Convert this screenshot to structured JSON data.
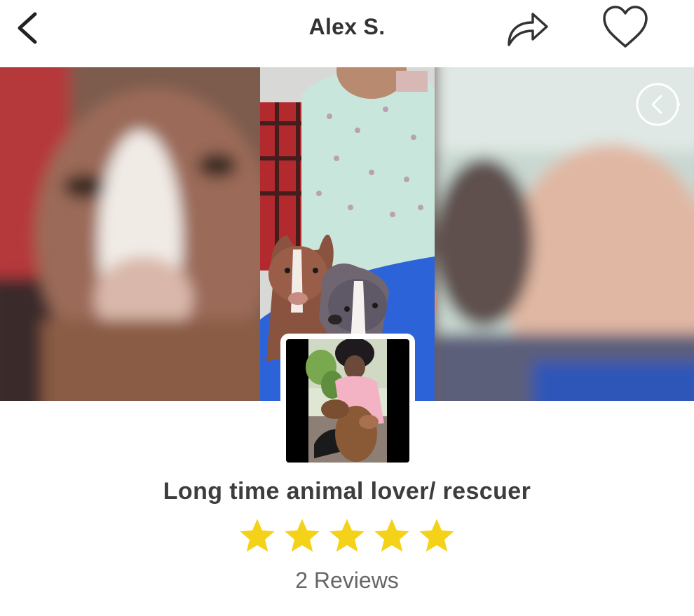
{
  "header": {
    "title": "Alex S.",
    "icons": {
      "back": "chevron-left-icon",
      "share": "share-arrow-icon",
      "favorite": "heart-outline-icon"
    }
  },
  "gallery": {
    "photos": [
      {
        "description_icon": "photo",
        "position": "left-blurred"
      },
      {
        "description_icon": "photo",
        "position": "center"
      },
      {
        "description_icon": "photo",
        "position": "right-blurred"
      }
    ],
    "prev_icon": "chevron-left-circle-icon"
  },
  "profile": {
    "tagline": "Long time animal lover/ rescuer",
    "rating": 5,
    "rating_max": 5,
    "reviews_label": "2 Reviews"
  },
  "colors": {
    "star": "#f5d21a",
    "text_primary": "#333333",
    "text_secondary": "#666666"
  }
}
